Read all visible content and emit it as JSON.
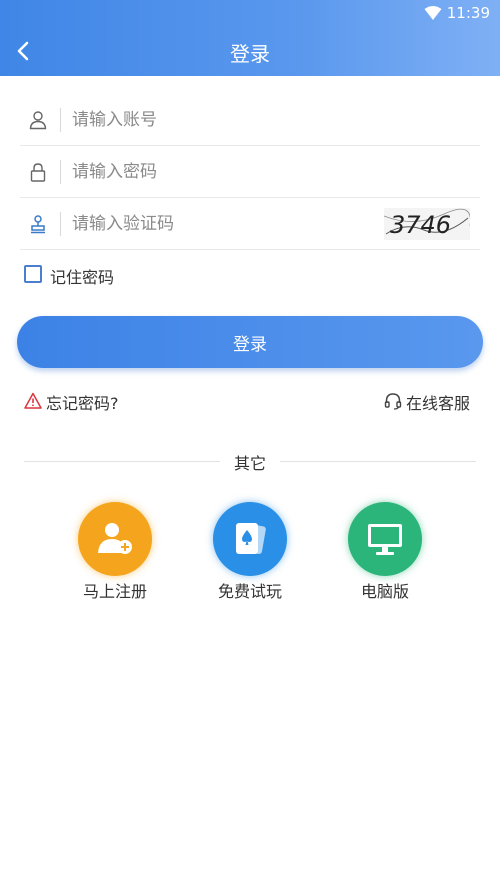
{
  "status_bar": {
    "time": "11:39",
    "wifi_icon": "wifi-icon"
  },
  "header": {
    "title": "登录",
    "back_icon": "chevron-left-icon"
  },
  "form": {
    "account": {
      "placeholder": "请输入账号",
      "value": "",
      "icon": "user-icon"
    },
    "password": {
      "placeholder": "请输入密码",
      "value": "",
      "icon": "lock-icon"
    },
    "captcha": {
      "placeholder": "请输入验证码",
      "value": "",
      "icon": "stamp-icon",
      "captcha_text": "3746"
    },
    "remember": {
      "label": "记住密码",
      "checked": false
    }
  },
  "login_button": {
    "label": "登录"
  },
  "links": {
    "forgot": {
      "label": "忘记密码?",
      "icon": "warning-icon"
    },
    "service": {
      "label": "在线客服",
      "icon": "headset-icon"
    }
  },
  "other": {
    "title": "其它",
    "items": [
      {
        "label": "马上注册",
        "icon": "add-user-icon",
        "color": "#f5a51d"
      },
      {
        "label": "免费试玩",
        "icon": "cards-icon",
        "color": "#2a8fe6"
      },
      {
        "label": "电脑版",
        "icon": "monitor-icon",
        "color": "#2bb57a"
      }
    ]
  },
  "colors": {
    "primary": "#3c82e6",
    "header_gradient_end": "#7fb0f5"
  }
}
